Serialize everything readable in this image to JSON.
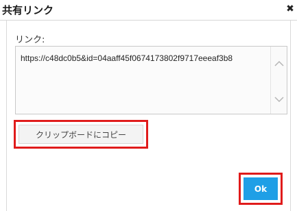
{
  "dialog": {
    "title": "共有リンク",
    "close_icon": "close-icon"
  },
  "link": {
    "label": "リンク:",
    "value": "https://c48dc0b5&id=04aaff45f0674173802f9717eeeaf3b8"
  },
  "buttons": {
    "copy_label": "クリップボードにコピー",
    "ok_label": "Ok"
  },
  "colors": {
    "highlight": "#e01b1b",
    "ok_button": "#1f9fe6"
  }
}
